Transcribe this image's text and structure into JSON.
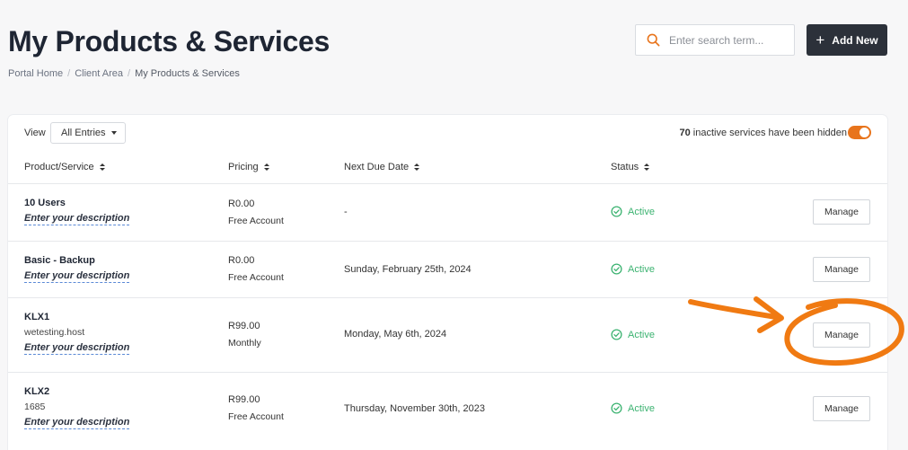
{
  "header": {
    "title": "My Products & Services",
    "breadcrumb": [
      "Portal Home",
      "Client Area",
      "My Products & Services"
    ],
    "search_placeholder": "Enter search term...",
    "add_label": "Add New"
  },
  "toolbar": {
    "view_label": "View",
    "view_selected": "All Entries",
    "inactive_count": "70",
    "inactive_text": "inactive services have been hidden",
    "inactive_toggle_on": true
  },
  "columns": [
    "Product/Service",
    "Pricing",
    "Next Due Date",
    "Status"
  ],
  "rows": [
    {
      "name": "10 Users",
      "domain": "",
      "description": "Enter your description",
      "price": "R0.00",
      "cycle": "Free Account",
      "due": "-",
      "status": "Active",
      "action": "Manage"
    },
    {
      "name": "Basic - Backup",
      "domain": "",
      "description": "Enter your description",
      "price": "R0.00",
      "cycle": "Free Account",
      "due": "Sunday, February 25th, 2024",
      "status": "Active",
      "action": "Manage"
    },
    {
      "name": "KLX1",
      "domain": "wetesting.host",
      "description": "Enter your description",
      "price": "R99.00",
      "cycle": "Monthly",
      "due": "Monday, May 6th, 2024",
      "status": "Active",
      "action": "Manage"
    },
    {
      "name": "KLX2",
      "domain": "1685",
      "description": "Enter your description",
      "price": "R99.00",
      "cycle": "Free Account",
      "due": "Thursday, November 30th, 2023",
      "status": "Active",
      "action": "Manage"
    }
  ],
  "colors": {
    "accent": "#e8741c",
    "status_active": "#3cb371",
    "button_dark": "#2c313a",
    "annotation": "#f07a12"
  },
  "icons": {
    "search": "search-icon",
    "add": "plus-icon",
    "status": "check-circle-icon",
    "sort": "sort-icon",
    "select": "caret-down-icon"
  }
}
